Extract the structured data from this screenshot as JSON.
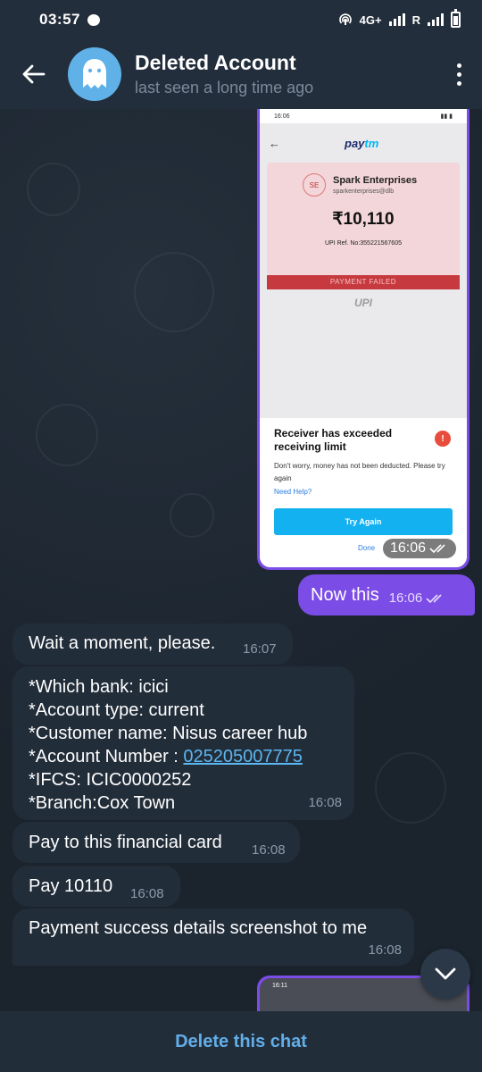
{
  "status_bar": {
    "time": "03:57",
    "network": "4G+",
    "roaming": "R"
  },
  "header": {
    "title": "Deleted Account",
    "subtitle": "last seen a long time ago"
  },
  "screenshot_message": {
    "inner_time": "16:06",
    "merchant_initials": "SE",
    "merchant_name": "Spark Enterprises",
    "merchant_upi": "sparkenterprises@dlb",
    "amount": "₹10,110",
    "upi_ref": "UPI Ref. No:355221567605",
    "status": "PAYMENT FAILED",
    "dialog_title": "Receiver has exceeded receiving limit",
    "dialog_text": "Don't worry, money has not been deducted. Please try again",
    "need_help": "Need Help?",
    "try_again": "Try Again",
    "done": "Done",
    "time": "16:06"
  },
  "messages": [
    {
      "direction": "out",
      "text": "Now this",
      "time": "16:06"
    },
    {
      "direction": "in",
      "text": "Wait a moment, please.",
      "time": "16:07"
    },
    {
      "direction": "in",
      "lines": [
        "*Which bank: icici",
        "*Account type: current",
        "*Customer name: Nisus career hub",
        "*Account Number : ",
        "*IFCS: ICIC0000252",
        "*Branch:Cox Town"
      ],
      "link": "025205007775",
      "time": "16:08"
    },
    {
      "direction": "in",
      "text": "Pay to this financial card",
      "time": "16:08"
    },
    {
      "direction": "in",
      "text": "Pay 10110",
      "time": "16:08"
    },
    {
      "direction": "in",
      "text": "Payment success details screenshot to me",
      "time": "16:08"
    }
  ],
  "screenshot_message_2": {
    "inner_time": "16:11"
  },
  "bottom": {
    "delete_label": "Delete this chat"
  },
  "colors": {
    "outgoing_bubble": "#7c4ce6",
    "incoming_bubble": "#222d3a",
    "header": "#232e3c",
    "accent_link": "#62aee8"
  }
}
